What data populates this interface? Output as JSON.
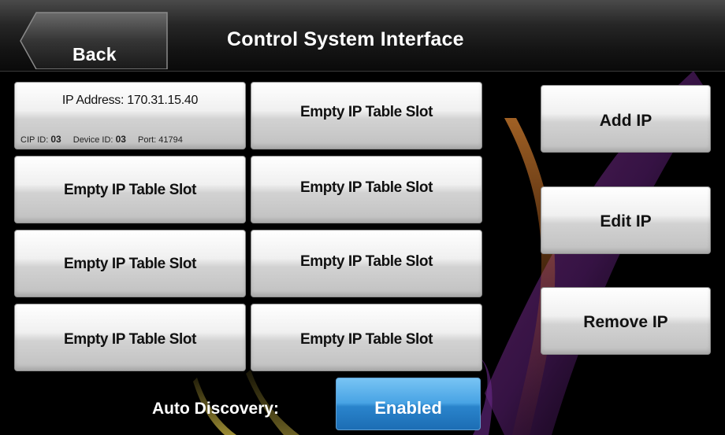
{
  "header": {
    "back_label": "Back",
    "title": "Control System Interface"
  },
  "ip_table": {
    "first_slot": {
      "ip_address": "IP Address: 170.31.15.40",
      "cip_id_label": "CIP ID:",
      "cip_id": "03",
      "device_id_label": "Device ID:",
      "device_id": "03",
      "port_label": "Port:",
      "port": "41794"
    },
    "empty_slot_label": "Empty IP Table Slot"
  },
  "actions": {
    "add_label": "Add IP",
    "edit_label": "Edit IP",
    "remove_label": "Remove IP"
  },
  "auto_discovery": {
    "label": "Auto Discovery:",
    "value": "Enabled"
  },
  "colors": {
    "accent_blue": "#2a84cc",
    "button_light": "#f0f0f0",
    "background": "#000000"
  }
}
